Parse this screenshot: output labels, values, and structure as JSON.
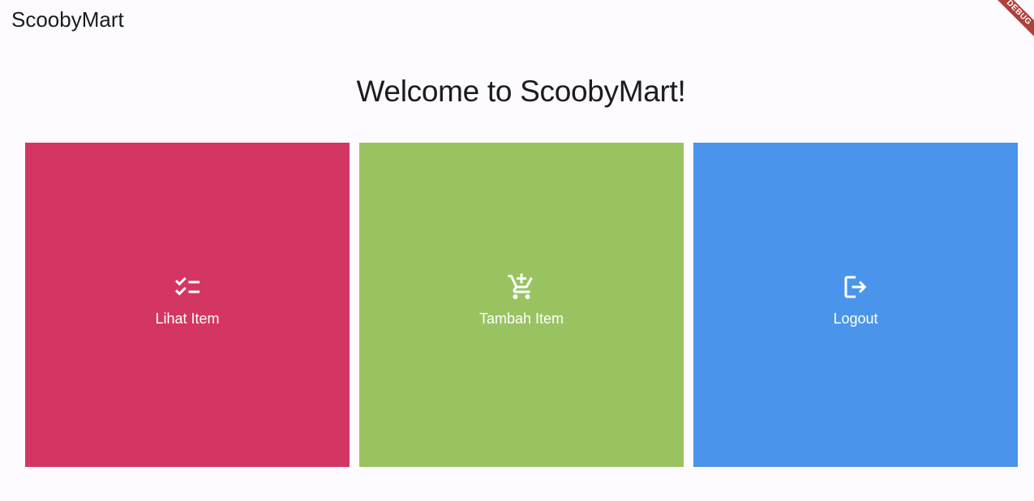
{
  "app_bar": {
    "title": "ScoobyMart"
  },
  "main": {
    "welcome_text": "Welcome to ScoobyMart!",
    "menu_items": [
      {
        "label": "Lihat Item",
        "icon": "checklist-icon",
        "color": "#d43663"
      },
      {
        "label": "Tambah Item",
        "icon": "add-to-cart-icon",
        "color": "#99c360"
      },
      {
        "label": "Logout",
        "icon": "logout-icon",
        "color": "#4a95eb"
      }
    ]
  },
  "debug_banner": {
    "text": "DEBUG"
  }
}
